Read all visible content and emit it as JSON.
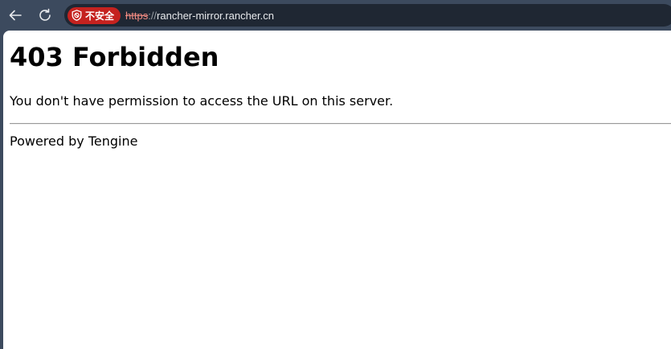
{
  "browser": {
    "back_icon": "arrow-left-icon",
    "reload_icon": "reload-icon",
    "security_chip": {
      "icon": "shield-warning-icon",
      "label": "不安全",
      "color": "#c5221f"
    },
    "url": {
      "scheme": "https",
      "separator": "://",
      "host": "rancher-mirror.rancher.cn"
    }
  },
  "page": {
    "title": "403 Forbidden",
    "message": "You don't have permission to access the URL on this server.",
    "footer": "Powered by Tengine"
  }
}
